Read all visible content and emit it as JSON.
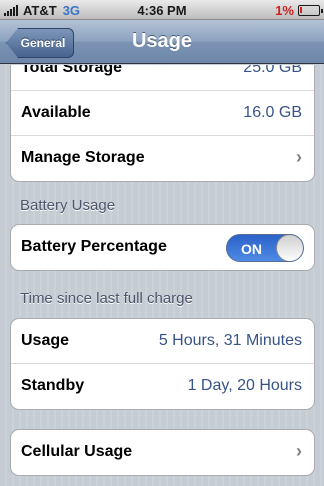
{
  "status_bar": {
    "carrier": "AT&T",
    "network": "3G",
    "time": "4:36 PM",
    "battery_percent": "1%",
    "battery_color": "#d1201f"
  },
  "nav": {
    "back_label": "General",
    "title": "Usage"
  },
  "storage": {
    "total_label": "Total Storage",
    "total_value": "25.0 GB",
    "available_label": "Available",
    "available_value": "16.0 GB",
    "manage_label": "Manage Storage"
  },
  "battery_usage": {
    "header": "Battery Usage",
    "percentage_label": "Battery Percentage",
    "toggle_state": "ON"
  },
  "time_since": {
    "header": "Time since last full charge",
    "usage_label": "Usage",
    "usage_value": "5 Hours, 31 Minutes",
    "standby_label": "Standby",
    "standby_value": "1 Day, 20 Hours"
  },
  "cellular": {
    "label": "Cellular Usage"
  },
  "colors": {
    "accent": "#385487",
    "nav_bar": "#7c93b3",
    "toggle_on": "#2a62c8"
  }
}
